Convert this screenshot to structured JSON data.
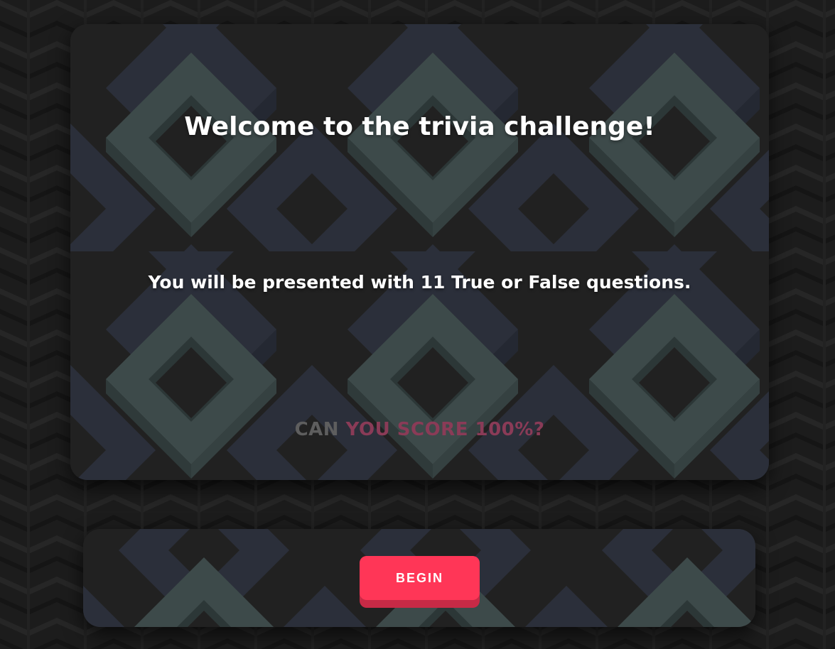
{
  "intro": {
    "title": "Welcome to the trivia challenge!",
    "subtitle": "You will be presented with 11 True or False questions.",
    "tagline_part1": "CAN",
    "tagline_part2": "YOU SCORE 100%?"
  },
  "actions": {
    "begin_label": "BEGIN"
  },
  "colors": {
    "accent": "#ff3657",
    "accent_shadow": "#c72a46",
    "card_bg": "#212121",
    "tile_green": "#3d4a4a",
    "tile_slate": "#2b2f38"
  }
}
